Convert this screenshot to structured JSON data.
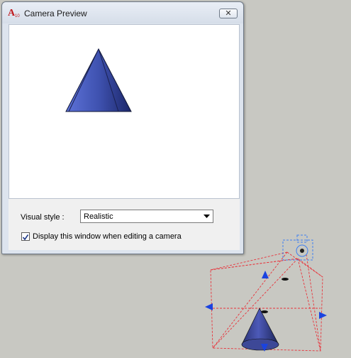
{
  "dialog": {
    "title": "Camera Preview",
    "app_icon_text": "A",
    "app_icon_subtext": "10",
    "close_glyph": "✕"
  },
  "controls": {
    "visual_style_label": "Visual style :",
    "visual_style_value": "Realistic",
    "display_window_label": "Display this window when editing a camera",
    "display_window_checked": true
  },
  "colors": {
    "cone_blue": "#3f52b0",
    "frustum_red": "#e8323a",
    "grip_blue": "#1a43e0",
    "camera_glyph_blue": "#3f7ff0"
  }
}
